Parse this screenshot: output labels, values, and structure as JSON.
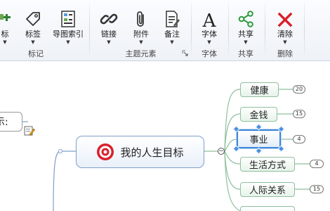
{
  "ribbon": {
    "buttons": {
      "marker": {
        "label": "标",
        "icon": "marker-icon"
      },
      "tag": {
        "label": "标签",
        "icon": "tag-icon"
      },
      "index": {
        "label": "导图索引",
        "icon": "index-icon"
      },
      "link": {
        "label": "链接",
        "icon": "link-icon"
      },
      "attachment": {
        "label": "附件",
        "icon": "paperclip-icon"
      },
      "note": {
        "label": "备注",
        "icon": "note-icon"
      },
      "font": {
        "label": "字体",
        "icon": "font-icon"
      },
      "share": {
        "label": "共享",
        "icon": "share-icon"
      },
      "clear": {
        "label": "清除",
        "icon": "clear-x-icon"
      }
    },
    "groups": {
      "marks": "标记",
      "topic_elements": "主题元素",
      "font": "字体",
      "share": "共享",
      "delete": "删除"
    }
  },
  "map": {
    "central_topic": "我的人生目标",
    "left_topic": "示:",
    "subtopics": [
      {
        "label": "健康",
        "count": "20"
      },
      {
        "label": "金钱",
        "count": "15"
      },
      {
        "label": "事业",
        "count": "4",
        "selected": true
      },
      {
        "label": "生活方式",
        "count": "4"
      },
      {
        "label": "人际关系",
        "count": "15"
      }
    ]
  },
  "colors": {
    "accent_red": "#d8212c",
    "share_green": "#2e9a3e",
    "selection_blue": "#3d86d9",
    "branch_green": "#8fbf9c"
  }
}
